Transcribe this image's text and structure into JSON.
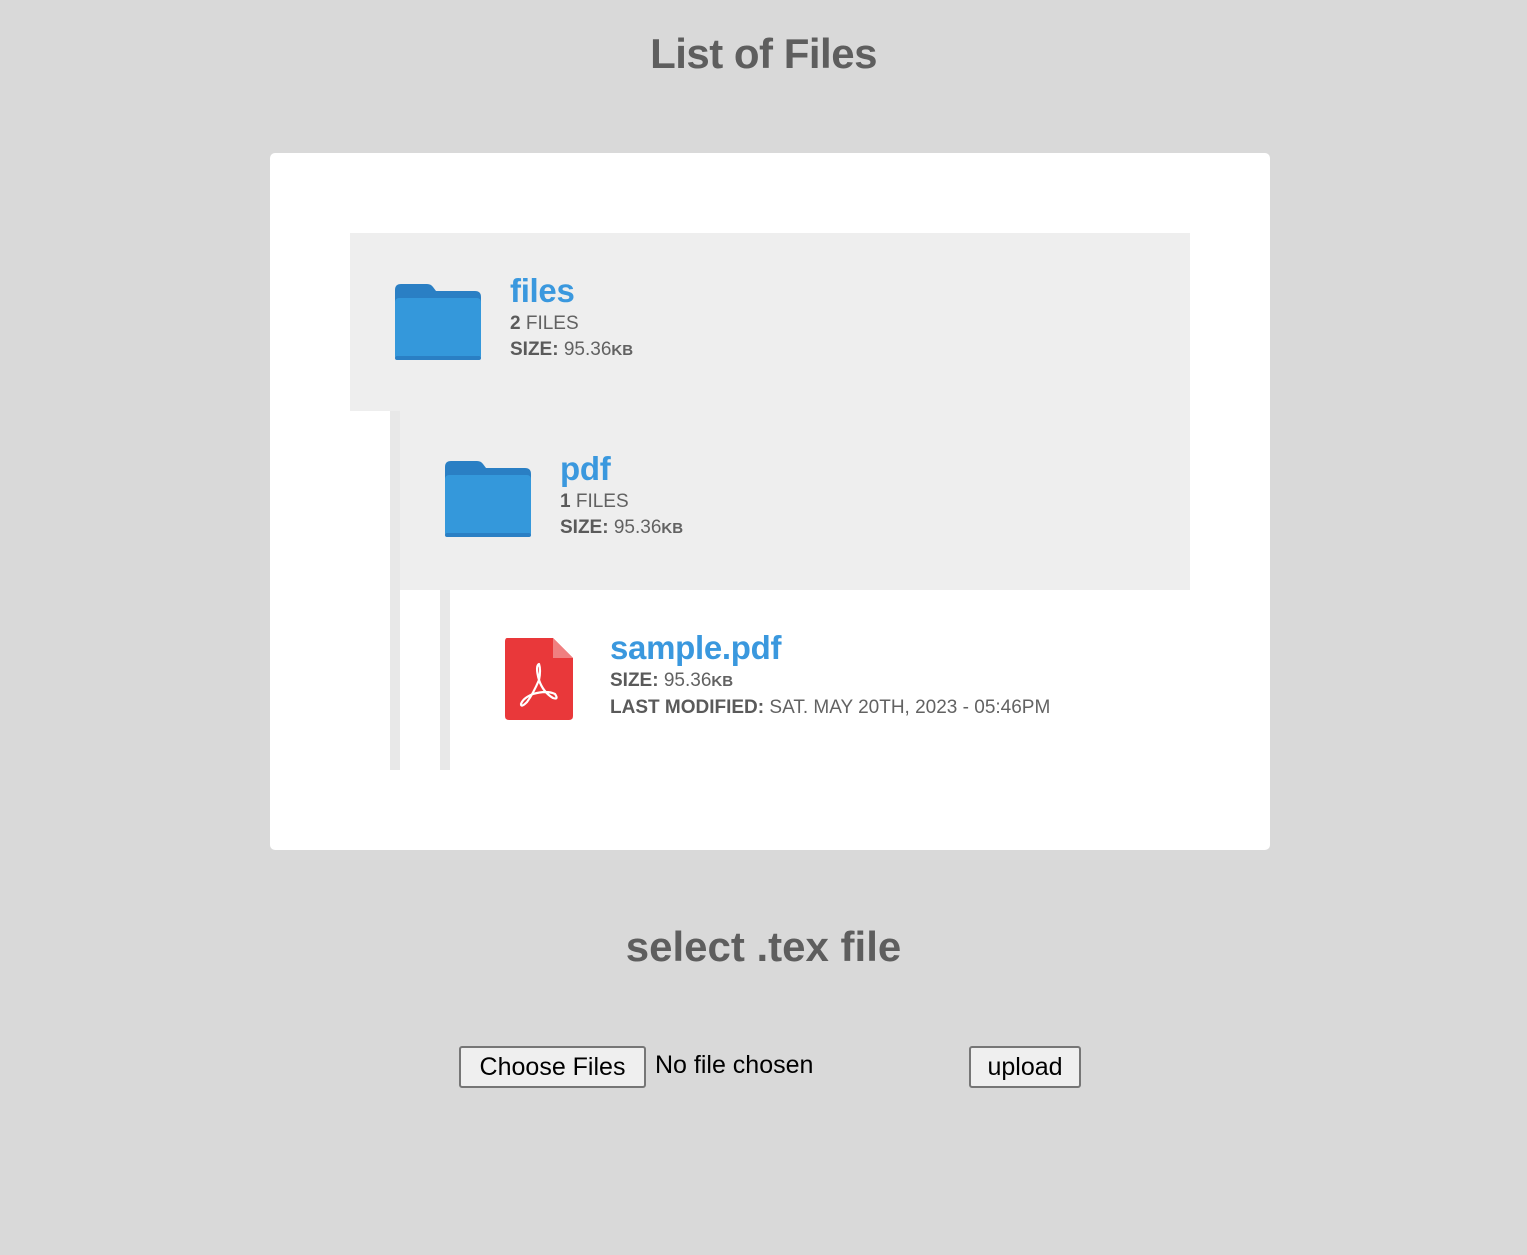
{
  "page": {
    "title": "List of Files",
    "upload_heading": "select .tex file"
  },
  "tree": {
    "root": {
      "name": "files",
      "count": "2",
      "count_label": "FILES",
      "size_label": "SIZE:",
      "size_value": "95.36",
      "size_unit": "KB",
      "icon": "folder-icon"
    },
    "pdf": {
      "name": "pdf",
      "count": "1",
      "count_label": "FILES",
      "size_label": "SIZE:",
      "size_value": "95.36",
      "size_unit": "KB",
      "icon": "folder-icon"
    },
    "file": {
      "name": "sample.pdf",
      "size_label": "SIZE:",
      "size_value": "95.36",
      "size_unit": "KB",
      "modified_label": "LAST MODIFIED:",
      "modified_value": "SAT. MAY 20TH, 2023 - 05:46PM",
      "icon": "pdf-file-icon"
    }
  },
  "upload": {
    "choose_label": "Choose Files",
    "no_file_text": "No file chosen",
    "upload_label": "upload"
  },
  "colors": {
    "background": "#d9d9d9",
    "card": "#ffffff",
    "folder_row": "#eeeeee",
    "accent_link": "#3a98de",
    "folder_icon": "#3498db",
    "pdf_icon": "#e9383a"
  }
}
